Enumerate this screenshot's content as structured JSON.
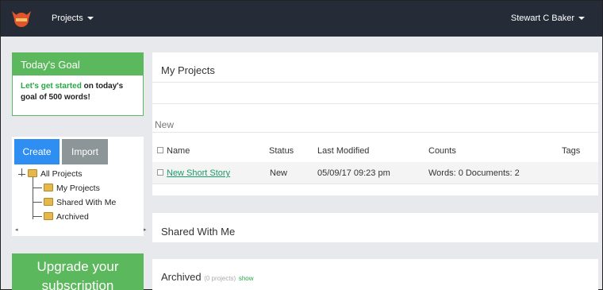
{
  "nav": {
    "projects_label": "Projects",
    "user_label": "Stewart C Baker"
  },
  "goal": {
    "title": "Today's Goal",
    "lead": "Let's get started",
    "rest": "on today's goal of 500 words!"
  },
  "actions": {
    "create_label": "Create",
    "import_label": "Import"
  },
  "tree": {
    "root": "All Projects",
    "children": [
      "My Projects",
      "Shared With Me",
      "Archived"
    ]
  },
  "upgrade": {
    "line1": "Upgrade your",
    "line2": "subscription"
  },
  "main": {
    "title": "My Projects",
    "section": "New",
    "columns": [
      "Name",
      "Status",
      "Last Modified",
      "Counts",
      "Tags"
    ],
    "rows": [
      {
        "name": "New Short Story",
        "status": "New",
        "modified": "05/09/17 09:23 pm",
        "counts": "Words: 0 Documents: 2",
        "tags": ""
      }
    ]
  },
  "shared": {
    "title": "Shared With Me"
  },
  "archived": {
    "title": "Archived",
    "count": "(0 projects)",
    "show": "show"
  },
  "colors": {
    "navbar": "#252c38",
    "green": "#5cb85c",
    "blue": "#2e8ef1",
    "grey_button": "#8c9597",
    "link": "#1a9a6a"
  }
}
